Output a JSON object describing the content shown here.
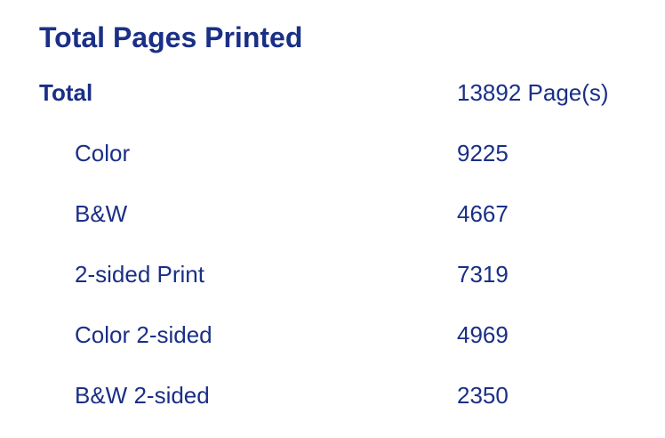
{
  "title": "Total Pages Printed",
  "stats": {
    "total": {
      "label": "Total",
      "value": "13892 Page(s)"
    },
    "color": {
      "label": "Color",
      "value": "9225"
    },
    "bw": {
      "label": "B&W",
      "value": "4667"
    },
    "two_sided": {
      "label": "2-sided Print",
      "value": "7319"
    },
    "color_two_sided": {
      "label": "Color 2-sided",
      "value": "4969"
    },
    "bw_two_sided": {
      "label": "B&W 2-sided",
      "value": "2350"
    }
  }
}
